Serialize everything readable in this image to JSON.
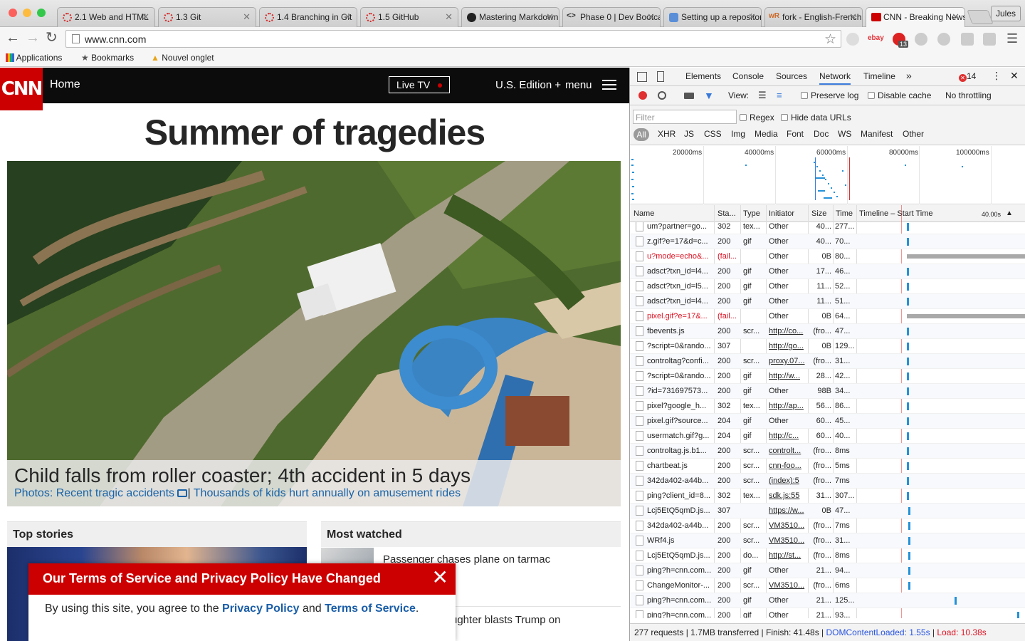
{
  "browser": {
    "tabs": [
      {
        "title": "2.1 Web and HTML",
        "icon": "loading-icon"
      },
      {
        "title": "1.3 Git",
        "icon": "loading-icon"
      },
      {
        "title": "1.4 Branching in Git",
        "icon": "loading-icon"
      },
      {
        "title": "1.5 GitHub",
        "icon": "loading-icon"
      },
      {
        "title": "Mastering Markdown",
        "icon": "github-icon"
      },
      {
        "title": "Phase 0 | Dev Bootcamp",
        "icon": "code-icon"
      },
      {
        "title": "Setting up a repository",
        "icon": "database-icon"
      },
      {
        "title": "fork - English-French",
        "icon": "wordreference-icon"
      },
      {
        "title": "CNN - Breaking News",
        "icon": "cnn-icon"
      }
    ],
    "profile": "Jules",
    "url": "www.cnn.com",
    "bookmarks": [
      "Applications",
      "Bookmarks",
      "Nouvel onglet"
    ],
    "ext_badge": "13",
    "ext_label": "ebay"
  },
  "cnn": {
    "logo": "CNN",
    "home": "Home",
    "live_tv": "Live TV",
    "edition": "U.S. Edition +",
    "menu": "menu",
    "headline": "Summer of tragedies",
    "hero_caption": "Child falls from roller coaster; 4th accident in 5 days",
    "hero_link1": "Photos: Recent tragic accidents",
    "hero_sep": "|",
    "hero_link2": "Thousands of kids hurt annually on amusement rides",
    "top_stories": "Top stories",
    "most_watched": "Most watched",
    "mw_item1": "Passenger chases plane on tarmac",
    "mw_item2": "ughter blasts Trump on",
    "tos_title": "Our Terms of Service and Privacy Policy Have Changed",
    "tos_text1": "By using this site, you agree to the ",
    "tos_link1": "Privacy Policy",
    "tos_text2": " and ",
    "tos_link2": "Terms of Service",
    "tos_text3": "."
  },
  "devtools": {
    "tabs": [
      "Elements",
      "Console",
      "Sources",
      "Network",
      "Timeline"
    ],
    "selected_tab": "Network",
    "error_count": "14",
    "view_label": "View:",
    "preserve_log": "Preserve log",
    "disable_cache": "Disable cache",
    "throttling": "No throttling",
    "filter_placeholder": "Filter",
    "regex": "Regex",
    "hide_data_urls": "Hide data URLs",
    "types": [
      "All",
      "XHR",
      "JS",
      "CSS",
      "Img",
      "Media",
      "Font",
      "Doc",
      "WS",
      "Manifest",
      "Other"
    ],
    "overview_ticks": [
      "20000ms",
      "40000ms",
      "60000ms",
      "80000ms",
      "100000ms"
    ],
    "columns": [
      "Name",
      "Sta...",
      "Type",
      "Initiator",
      "Size",
      "Time",
      "Timeline – Start Time"
    ],
    "timeline_scale": "40.00s",
    "rows": [
      {
        "name": "um?partner=go...",
        "status": "302",
        "type": "tex...",
        "initiator": "Other",
        "size": "40...",
        "time": "277...",
        "link": false,
        "fail": false,
        "bar": 0.3,
        "icon": false
      },
      {
        "name": "z.gif?e=17&d=c...",
        "status": "200",
        "type": "gif",
        "initiator": "Other",
        "size": "40...",
        "time": "70...",
        "link": false,
        "fail": false,
        "bar": 0.3,
        "icon": false
      },
      {
        "name": "u?mode=echo&...",
        "status": "(fail...",
        "type": "",
        "initiator": "Other",
        "size": "0B",
        "time": "80...",
        "link": false,
        "fail": true,
        "bar": 0.3,
        "icon": false
      },
      {
        "name": "adsct?txn_id=l4...",
        "status": "200",
        "type": "gif",
        "initiator": "Other",
        "size": "17...",
        "time": "46...",
        "link": false,
        "fail": false,
        "bar": 0.3,
        "icon": false
      },
      {
        "name": "adsct?txn_id=l5...",
        "status": "200",
        "type": "gif",
        "initiator": "Other",
        "size": "11...",
        "time": "52...",
        "link": false,
        "fail": false,
        "bar": 0.3,
        "icon": false
      },
      {
        "name": "adsct?txn_id=l4...",
        "status": "200",
        "type": "gif",
        "initiator": "Other",
        "size": "11...",
        "time": "51...",
        "link": false,
        "fail": false,
        "bar": 0.3,
        "icon": false
      },
      {
        "name": "pixel.gif?e=17&...",
        "status": "(fail...",
        "type": "",
        "initiator": "Other",
        "size": "0B",
        "time": "64...",
        "link": false,
        "fail": true,
        "bar": 0.3,
        "icon": false
      },
      {
        "name": "fbevents.js",
        "status": "200",
        "type": "scr...",
        "initiator": "http://co...",
        "size": "(fro...",
        "time": "47...",
        "link": true,
        "fail": false,
        "bar": 0.3,
        "icon": false
      },
      {
        "name": "?script=0&rando...",
        "status": "307",
        "type": "",
        "initiator": "http://go...",
        "size": "0B",
        "time": "129...",
        "link": true,
        "fail": false,
        "bar": 0.3,
        "icon": false
      },
      {
        "name": "controltag?confi...",
        "status": "200",
        "type": "scr...",
        "initiator": "proxy.07...",
        "size": "(fro...",
        "time": "31...",
        "link": true,
        "fail": false,
        "bar": 0.3,
        "icon": false
      },
      {
        "name": "?script=0&rando...",
        "status": "200",
        "type": "gif",
        "initiator": "http://w...",
        "size": "28...",
        "time": "42...",
        "link": true,
        "fail": false,
        "bar": 0.3,
        "icon": false
      },
      {
        "name": "?id=731697573...",
        "status": "200",
        "type": "gif",
        "initiator": "Other",
        "size": "98B",
        "time": "34...",
        "link": false,
        "fail": false,
        "bar": 0.3,
        "icon": false
      },
      {
        "name": "pixel?google_h...",
        "status": "302",
        "type": "tex...",
        "initiator": "http://ap...",
        "size": "56...",
        "time": "86...",
        "link": true,
        "fail": false,
        "bar": 0.3,
        "icon": false
      },
      {
        "name": "pixel.gif?source...",
        "status": "204",
        "type": "gif",
        "initiator": "Other",
        "size": "60...",
        "time": "45...",
        "link": false,
        "fail": false,
        "bar": 0.3,
        "icon": true
      },
      {
        "name": "usermatch.gif?g...",
        "status": "204",
        "type": "gif",
        "initiator": "http://c...",
        "size": "60...",
        "time": "40...",
        "link": true,
        "fail": false,
        "bar": 0.3,
        "icon": true
      },
      {
        "name": "controltag.js.b1...",
        "status": "200",
        "type": "scr...",
        "initiator": "controlt...",
        "size": "(fro...",
        "time": "8ms",
        "link": true,
        "fail": false,
        "bar": 0.3,
        "icon": false
      },
      {
        "name": "chartbeat.js",
        "status": "200",
        "type": "scr...",
        "initiator": "cnn-foo...",
        "size": "(fro...",
        "time": "5ms",
        "link": true,
        "fail": false,
        "bar": 0.3,
        "icon": false
      },
      {
        "name": "342da402-a44b...",
        "status": "200",
        "type": "scr...",
        "initiator": "(index):5",
        "size": "(fro...",
        "time": "7ms",
        "link": true,
        "fail": false,
        "bar": 0.3,
        "icon": false
      },
      {
        "name": "ping?client_id=8...",
        "status": "302",
        "type": "tex...",
        "initiator": "sdk.js:55",
        "size": "31...",
        "time": "307...",
        "link": true,
        "fail": false,
        "bar": 0.3,
        "icon": false
      },
      {
        "name": "Lcj5EtQ5qmD.js...",
        "status": "307",
        "type": "",
        "initiator": "https://w...",
        "size": "0B",
        "time": "47...",
        "link": true,
        "fail": false,
        "bar": 0.31,
        "icon": false
      },
      {
        "name": "342da402-a44b...",
        "status": "200",
        "type": "scr...",
        "initiator": "VM3510...",
        "size": "(fro...",
        "time": "7ms",
        "link": true,
        "fail": false,
        "bar": 0.31,
        "icon": false
      },
      {
        "name": "WRf4.js",
        "status": "200",
        "type": "scr...",
        "initiator": "VM3510...",
        "size": "(fro...",
        "time": "31...",
        "link": true,
        "fail": false,
        "bar": 0.31,
        "icon": false
      },
      {
        "name": "Lcj5EtQ5qmD.js...",
        "status": "200",
        "type": "do...",
        "initiator": "http://st...",
        "size": "(fro...",
        "time": "8ms",
        "link": true,
        "fail": false,
        "bar": 0.31,
        "icon": false
      },
      {
        "name": "ping?h=cnn.com...",
        "status": "200",
        "type": "gif",
        "initiator": "Other",
        "size": "21...",
        "time": "94...",
        "link": false,
        "fail": false,
        "bar": 0.31,
        "icon": false
      },
      {
        "name": "ChangeMonitor-...",
        "status": "200",
        "type": "scr...",
        "initiator": "VM3510...",
        "size": "(fro...",
        "time": "6ms",
        "link": true,
        "fail": false,
        "bar": 0.31,
        "icon": false
      },
      {
        "name": "ping?h=cnn.com...",
        "status": "200",
        "type": "gif",
        "initiator": "Other",
        "size": "21...",
        "time": "125...",
        "link": false,
        "fail": false,
        "bar": 0.6,
        "icon": false
      },
      {
        "name": "ping?h=cnn.com...",
        "status": "200",
        "type": "gif",
        "initiator": "Other",
        "size": "21...",
        "time": "93...",
        "link": false,
        "fail": false,
        "bar": 0.99,
        "icon": false
      }
    ],
    "status": {
      "summary": "277 requests | 1.7MB transferred | Finish: 41.48s | ",
      "dom": "DOMContentLoaded: 1.55s",
      "sep": " | ",
      "load": "Load: 10.38s"
    }
  }
}
